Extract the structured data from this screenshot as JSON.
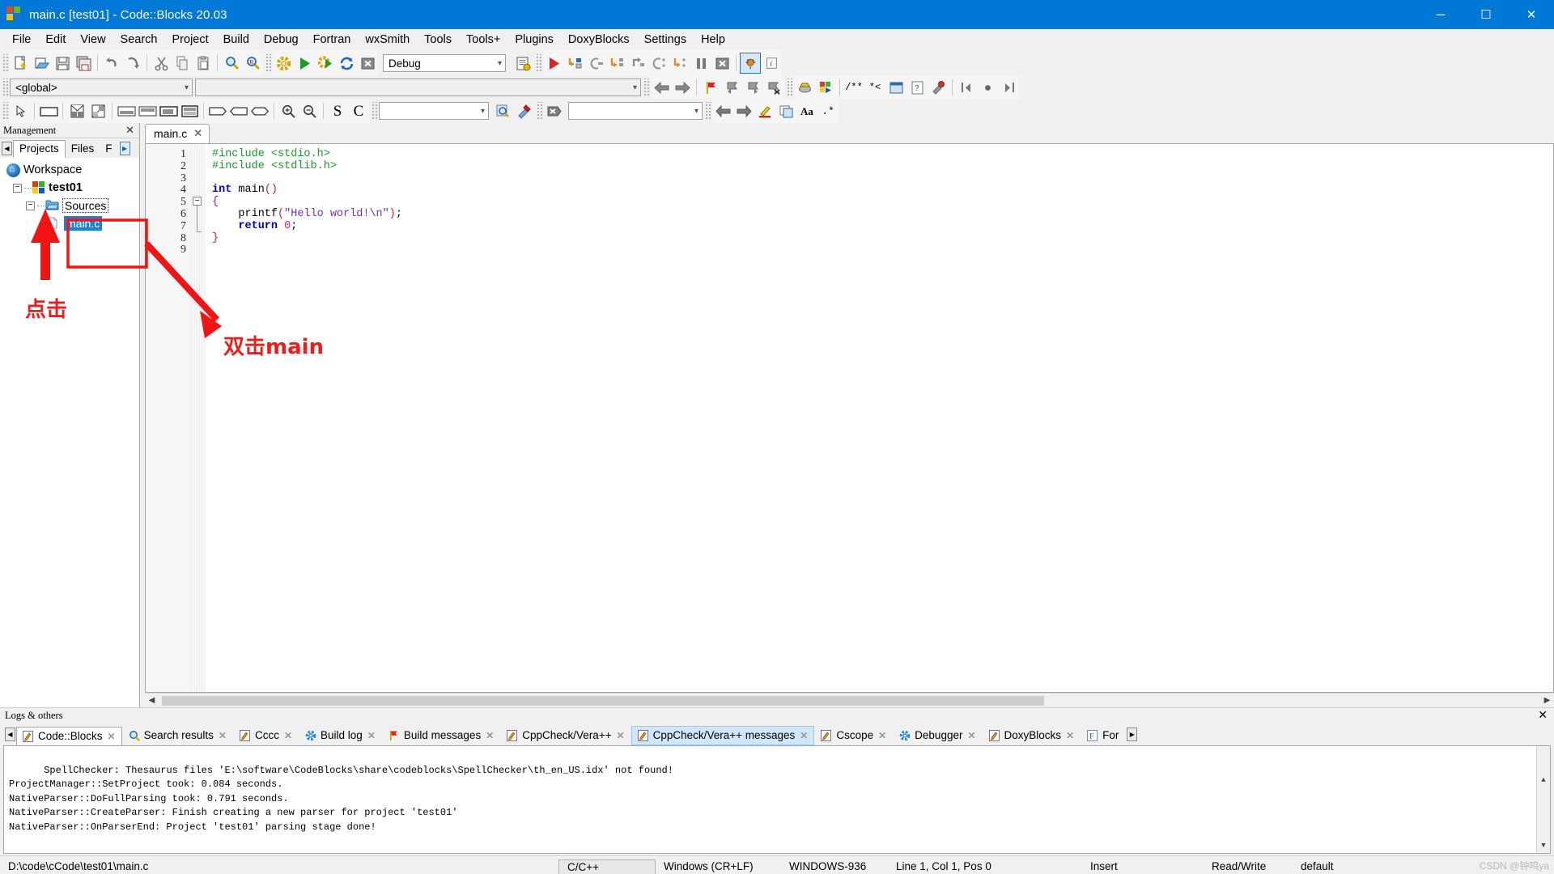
{
  "window": {
    "title": "main.c [test01] - Code::Blocks 20.03",
    "minimize": "─",
    "maximize": "☐",
    "close": "✕"
  },
  "menubar": [
    {
      "label": "File"
    },
    {
      "label": "Edit"
    },
    {
      "label": "View"
    },
    {
      "label": "Search"
    },
    {
      "label": "Project"
    },
    {
      "label": "Build"
    },
    {
      "label": "Debug"
    },
    {
      "label": "Fortran"
    },
    {
      "label": "wxSmith"
    },
    {
      "label": "Tools"
    },
    {
      "label": "Tools+"
    },
    {
      "label": "Plugins"
    },
    {
      "label": "DoxyBlocks"
    },
    {
      "label": "Settings"
    },
    {
      "label": "Help"
    }
  ],
  "toolbars": {
    "build_target": "Debug",
    "scope_combo": "<global>",
    "function_combo": "",
    "search_combo": "",
    "goto_combo": "",
    "icons_main": [
      "new-file-icon",
      "open-file-icon",
      "save-icon",
      "save-all-icon",
      "undo-icon",
      "redo-icon",
      "cut-icon",
      "copy-icon",
      "paste-icon",
      "find-icon",
      "replace-icon"
    ],
    "icons_compile": [
      "build-icon",
      "run-icon",
      "build-and-run-icon",
      "rebuild-icon",
      "abort-icon"
    ],
    "icons_debug": [
      "debug-continue-icon",
      "debug-run-to-cursor-icon",
      "debug-next-line-icon",
      "debug-step-into-icon",
      "debug-step-out-icon",
      "debug-next-instruction-icon",
      "debug-step-into-instruction-icon",
      "debug-break-icon",
      "debug-stop-icon"
    ],
    "icons_extra": [
      "debugging-windows-icon",
      "various-info-icon"
    ],
    "icons_nav": [
      "back-icon",
      "forward-icon",
      "toggle-bookmark-icon",
      "prev-bookmark-icon",
      "next-bookmark-icon",
      "clear-bookmarks-icon"
    ],
    "icons_plugin": [
      "fortran-icon",
      "codeblocks-icon",
      "doxyblocks-comment-icon",
      "doxyblocks-block-icon",
      "doxyblocks-run-icon",
      "doxyblocks-help-icon",
      "doxyblocks-config-icon",
      "prev-function-icon",
      "jump-icon",
      "next-function-icon"
    ],
    "icons_wxsmith": [
      "pointer-icon",
      "panel-icon",
      "box-sizer-icon",
      "grid-sizer-icon",
      "top-align-icon",
      "bottom-align-icon",
      "left-align-icon",
      "fill-icon",
      "spacer-icon",
      "shrink-icon",
      "expand-icon",
      "zoom-in-icon",
      "zoom-out-icon",
      "s-icon",
      "c-icon"
    ],
    "icons_search": [
      "search-decl-icon",
      "search-impl-icon",
      "clear-icon"
    ]
  },
  "management": {
    "title": "Management",
    "close_icon": "✕",
    "tabs": [
      {
        "label": "Projects",
        "active": true
      },
      {
        "label": "Files",
        "active": false
      },
      {
        "label": "F",
        "active": false
      }
    ],
    "tree": {
      "workspace": "Workspace",
      "project": "test01",
      "sources_folder": "Sources",
      "file": "main.c"
    }
  },
  "editor": {
    "tab": {
      "label": "main.c",
      "close": "✕"
    },
    "line_numbers": [
      "1",
      "2",
      "3",
      "4",
      "5",
      "6",
      "7",
      "8",
      "9"
    ],
    "code_lines": [
      {
        "n": 1,
        "tokens": [
          {
            "t": "#include ",
            "c": "c-pre"
          },
          {
            "t": "<stdio.h>",
            "c": "c-pre"
          }
        ]
      },
      {
        "n": 2,
        "tokens": [
          {
            "t": "#include ",
            "c": "c-pre"
          },
          {
            "t": "<stdlib.h>",
            "c": "c-pre"
          }
        ]
      },
      {
        "n": 3,
        "tokens": []
      },
      {
        "n": 4,
        "tokens": [
          {
            "t": "int",
            "c": "c-kw"
          },
          {
            "t": " main",
            "c": "c-plain"
          },
          {
            "t": "()",
            "c": "c-brace"
          }
        ]
      },
      {
        "n": 5,
        "tokens": [
          {
            "t": "{",
            "c": "c-brace"
          }
        ]
      },
      {
        "n": 6,
        "tokens": [
          {
            "t": "    printf",
            "c": "c-plain"
          },
          {
            "t": "(",
            "c": "c-brace"
          },
          {
            "t": "\"Hello world!\\n\"",
            "c": "c-str"
          },
          {
            "t": ")",
            "c": "c-brace"
          },
          {
            "t": ";",
            "c": "c-plain"
          }
        ]
      },
      {
        "n": 7,
        "tokens": [
          {
            "t": "    return",
            "c": "c-kw"
          },
          {
            "t": " 0",
            "c": "c-num"
          },
          {
            "t": ";",
            "c": "c-plain"
          }
        ]
      },
      {
        "n": 8,
        "tokens": [
          {
            "t": "}",
            "c": "c-brace"
          }
        ]
      },
      {
        "n": 9,
        "tokens": []
      }
    ]
  },
  "logs": {
    "title": "Logs & others",
    "close_icon": "✕",
    "tabs": [
      {
        "label": "Code::Blocks",
        "icon": "pencil-icon",
        "state": "active"
      },
      {
        "label": "Search results",
        "icon": "magnifier-icon",
        "state": "normal"
      },
      {
        "label": "Cccc",
        "icon": "pencil-icon",
        "state": "normal"
      },
      {
        "label": "Build log",
        "icon": "gear-icon",
        "state": "normal"
      },
      {
        "label": "Build messages",
        "icon": "flag-icon",
        "state": "normal"
      },
      {
        "label": "CppCheck/Vera++",
        "icon": "pencil-icon",
        "state": "normal"
      },
      {
        "label": "CppCheck/Vera++ messages",
        "icon": "pencil-icon",
        "state": "selected"
      },
      {
        "label": "Cscope",
        "icon": "pencil-icon",
        "state": "normal"
      },
      {
        "label": "Debugger",
        "icon": "gear-icon",
        "state": "normal"
      },
      {
        "label": "DoxyBlocks",
        "icon": "pencil-icon",
        "state": "normal"
      },
      {
        "label": "For",
        "icon": "f-icon",
        "state": "normal"
      }
    ],
    "content": "SpellChecker: Thesaurus files 'E:\\software\\CodeBlocks\\share\\codeblocks\\SpellChecker\\th_en_US.idx' not found!\nProjectManager::SetProject took: 0.084 seconds.\nNativeParser::DoFullParsing took: 0.791 seconds.\nNativeParser::CreateParser: Finish creating a new parser for project 'test01'\nNativeParser::OnParserEnd: Project 'test01' parsing stage done!"
  },
  "statusbar": {
    "path": "D:\\code\\cCode\\test01\\main.c",
    "language": "C/C++",
    "line_ending": "Windows (CR+LF)",
    "encoding": "WINDOWS-936",
    "caret": "Line 1, Col 1, Pos 0",
    "mode": "Insert",
    "access": "Read/Write",
    "profile": "default",
    "watermark": "CSDN @钟鸣ya"
  },
  "annotations": {
    "click_label": "点击",
    "double_click_label": "双击main",
    "color": "#f01414"
  }
}
